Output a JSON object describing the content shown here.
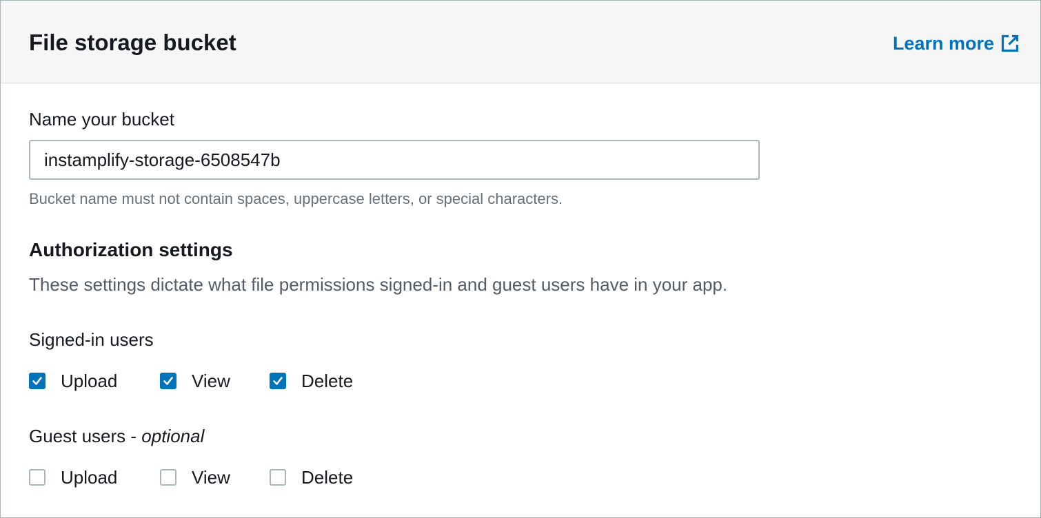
{
  "header": {
    "title": "File storage bucket",
    "learn_more_label": "Learn more",
    "learn_more_icon": "external-link-icon",
    "link_color": "#0073bb"
  },
  "bucket": {
    "label": "Name your bucket",
    "value": "instamplify-storage-6508547b",
    "constraint": "Bucket name must not contain spaces, uppercase letters, or special characters."
  },
  "authorization": {
    "heading": "Authorization settings",
    "description": "These settings dictate what file permissions signed-in and guest users have in your app.",
    "signed_in": {
      "label": "Signed-in users",
      "options": [
        {
          "label": "Upload",
          "checked": true
        },
        {
          "label": "View",
          "checked": true
        },
        {
          "label": "Delete",
          "checked": true
        }
      ]
    },
    "guest": {
      "label": "Guest users - ",
      "label_suffix": "optional",
      "options": [
        {
          "label": "Upload",
          "checked": false
        },
        {
          "label": "View",
          "checked": false
        },
        {
          "label": "Delete",
          "checked": false
        }
      ]
    }
  },
  "colors": {
    "checkbox_checked": "#0073bb",
    "checkbox_border": "#aab7b8",
    "header_background": "#f6f6f6"
  }
}
